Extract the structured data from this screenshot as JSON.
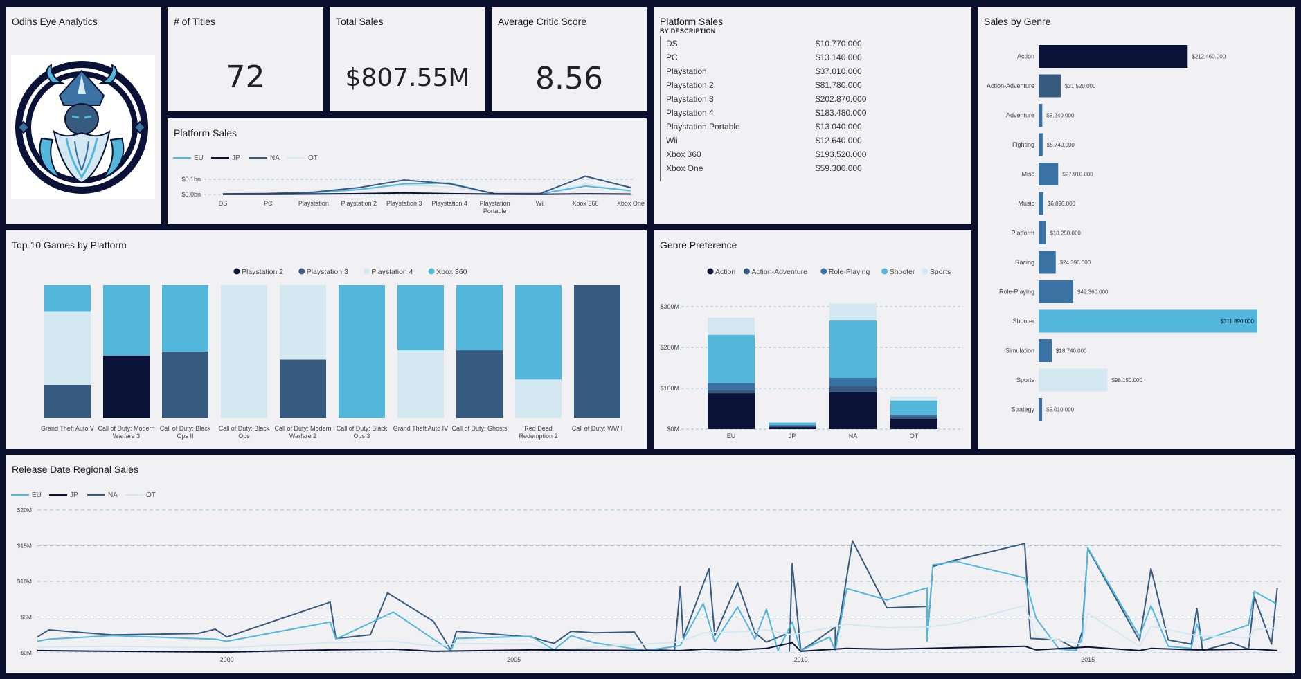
{
  "colors": {
    "background": "#0a0f2e",
    "card": "#f1f1f4",
    "navy": "#0b1237",
    "slate": "#375a7f",
    "sky": "#52b7da",
    "pale": "#d3e8f1"
  },
  "logo_card": {
    "title": "Odins Eye Analytics",
    "logo_icon": "viking-odin-logo-icon"
  },
  "kpis": [
    {
      "title": "# of Titles",
      "value": "72"
    },
    {
      "title": "Total Sales",
      "value": "$807.55M"
    },
    {
      "title": "Average Critic Score",
      "value": "8.56"
    }
  ],
  "platform_line": {
    "title": "Platform Sales",
    "legend": [
      "EU",
      "JP",
      "NA",
      "OT"
    ],
    "categories": [
      "DS",
      "PC",
      "Playstation",
      "Playstation 2",
      "Playstation 3",
      "Playstation 4",
      "Playstation Portable",
      "Wii",
      "Xbox 360",
      "Xbox One"
    ],
    "yticks": [
      "$0.1bn",
      "$0.0bn"
    ]
  },
  "platform_table": {
    "title": "Platform Sales",
    "subtitle": "BY DESCRIPTION",
    "rows": [
      {
        "name": "DS",
        "value": "$10.770.000"
      },
      {
        "name": "PC",
        "value": "$13.140.000"
      },
      {
        "name": "Playstation",
        "value": "$37.010.000"
      },
      {
        "name": "Playstation 2",
        "value": "$81.780.000"
      },
      {
        "name": "Playstation 3",
        "value": "$202.870.000"
      },
      {
        "name": "Playstation 4",
        "value": "$183.480.000"
      },
      {
        "name": "Playstation Portable",
        "value": "$13.040.000"
      },
      {
        "name": "Wii",
        "value": "$12.640.000"
      },
      {
        "name": "Xbox 360",
        "value": "$193.520.000"
      },
      {
        "name": "Xbox One",
        "value": "$59.300.000"
      }
    ]
  },
  "genre_bar": {
    "title": "Sales by Genre",
    "items": [
      {
        "genre": "Action",
        "label": "$212.460.000",
        "value": 212.46,
        "color": "#0b1237"
      },
      {
        "genre": "Action-Adventure",
        "label": "$31.520.000",
        "value": 31.52,
        "color": "#375a7f"
      },
      {
        "genre": "Adventure",
        "label": "$5.240.000",
        "value": 5.24,
        "color": "#3a72a4"
      },
      {
        "genre": "Fighting",
        "label": "$5.740.000",
        "value": 5.74,
        "color": "#3a72a4"
      },
      {
        "genre": "Misc",
        "label": "$27.910.000",
        "value": 27.91,
        "color": "#3a72a4"
      },
      {
        "genre": "Music",
        "label": "$6.890.000",
        "value": 6.89,
        "color": "#3a72a4"
      },
      {
        "genre": "Platform",
        "label": "$10.250.000",
        "value": 10.25,
        "color": "#3a72a4"
      },
      {
        "genre": "Racing",
        "label": "$24.390.000",
        "value": 24.39,
        "color": "#3a72a4"
      },
      {
        "genre": "Role-Playing",
        "label": "$49.360.000",
        "value": 49.36,
        "color": "#3a72a4"
      },
      {
        "genre": "Shooter",
        "label": "$311.890.000",
        "value": 311.89,
        "color": "#52b7da"
      },
      {
        "genre": "Simulation",
        "label": "$18.740.000",
        "value": 18.74,
        "color": "#3a72a4"
      },
      {
        "genre": "Sports",
        "label": "$98.150.000",
        "value": 98.15,
        "color": "#d3e8f1"
      },
      {
        "genre": "Strategy",
        "label": "$5.010.000",
        "value": 5.01,
        "color": "#3a72a4"
      }
    ]
  },
  "top10": {
    "title": "Top 10 Games by Platform",
    "legend": [
      {
        "name": "Playstation 2",
        "color": "#0b1237"
      },
      {
        "name": "Playstation 3",
        "color": "#375a7f"
      },
      {
        "name": "Playstation 4",
        "color": "#d3e8f1"
      },
      {
        "name": "Xbox 360",
        "color": "#52b7da"
      }
    ],
    "games": [
      {
        "name": [
          "Grand Theft Auto V"
        ],
        "segments": [
          [
            "Playstation 3",
            0.25
          ],
          [
            "Playstation 4",
            0.55
          ],
          [
            "Xbox 360",
            0.2
          ]
        ]
      },
      {
        "name": [
          "Call of Duty: Modern",
          "Warfare 3"
        ],
        "segments": [
          [
            "Playstation 2",
            0.47
          ],
          [
            "Xbox 360",
            0.53
          ]
        ]
      },
      {
        "name": [
          "Call of Duty: Black",
          "Ops II"
        ],
        "segments": [
          [
            "Playstation 3",
            0.5
          ],
          [
            "Xbox 360",
            0.5
          ]
        ]
      },
      {
        "name": [
          "Call of Duty: Black",
          "Ops"
        ],
        "segments": [
          [
            "Playstation 4",
            1.0
          ]
        ]
      },
      {
        "name": [
          "Call of Duty: Modern",
          "Warfare 2"
        ],
        "segments": [
          [
            "Playstation 3",
            0.44
          ],
          [
            "Playstation 4",
            0.56
          ]
        ]
      },
      {
        "name": [
          "Call of Duty: Black",
          "Ops 3"
        ],
        "segments": [
          [
            "Xbox 360",
            1.0
          ]
        ]
      },
      {
        "name": [
          "Grand Theft Auto IV"
        ],
        "segments": [
          [
            "Playstation 4",
            0.51
          ],
          [
            "Xbox 360",
            0.49
          ]
        ]
      },
      {
        "name": [
          "Call of Duty: Ghosts"
        ],
        "segments": [
          [
            "Playstation 3",
            0.51
          ],
          [
            "Xbox 360",
            0.49
          ]
        ]
      },
      {
        "name": [
          "Red Dead",
          "Redemption 2"
        ],
        "segments": [
          [
            "Playstation 4",
            0.29
          ],
          [
            "Xbox 360",
            0.71
          ]
        ]
      },
      {
        "name": [
          "Call of Duty: WWII"
        ],
        "segments": [
          [
            "Playstation 3",
            1.0
          ]
        ]
      }
    ]
  },
  "genre_pref": {
    "title": "Genre Preference",
    "legend": [
      {
        "name": "Action",
        "color": "#0b1237"
      },
      {
        "name": "Action-Adventure",
        "color": "#375a7f"
      },
      {
        "name": "Role-Playing",
        "color": "#3a72a4"
      },
      {
        "name": "Shooter",
        "color": "#52b7da"
      },
      {
        "name": "Sports",
        "color": "#d3e8f1"
      }
    ],
    "yticks": [
      "$300M",
      "$200M",
      "$100M",
      "$0M"
    ],
    "ymax": 300,
    "regions": [
      {
        "name": "EU",
        "values": [
          88,
          8,
          17,
          118,
          42
        ]
      },
      {
        "name": "JP",
        "values": [
          5,
          2,
          3,
          6,
          2
        ]
      },
      {
        "name": "NA",
        "values": [
          90,
          16,
          20,
          140,
          42
        ]
      },
      {
        "name": "OT",
        "values": [
          26,
          4,
          6,
          34,
          10
        ]
      }
    ]
  },
  "release": {
    "title": "Release Date Regional Sales",
    "legend": [
      "EU",
      "JP",
      "NA",
      "OT"
    ],
    "yticks": [
      "$20M",
      "$15M",
      "$10M",
      "$5M",
      "$0M"
    ],
    "xticks": [
      "2000",
      "2005",
      "2010",
      "2015"
    ],
    "ymax": 20,
    "xrange": [
      1996.7,
      2018.4
    ],
    "series": [
      {
        "name": "NA",
        "color": "#375a7f",
        "points": [
          [
            1996.7,
            2.2
          ],
          [
            1996.9,
            3.2
          ],
          [
            1998,
            2.5
          ],
          [
            1999.5,
            2.7
          ],
          [
            1999.8,
            3.3
          ],
          [
            2000,
            2.2
          ],
          [
            2001.8,
            7.1
          ],
          [
            2001.9,
            2
          ],
          [
            2002.5,
            2.5
          ],
          [
            2002.8,
            8.4
          ],
          [
            2003.6,
            4.4
          ],
          [
            2003.9,
            0.4
          ],
          [
            2004,
            3
          ],
          [
            2005.3,
            2.2
          ],
          [
            2005.7,
            1.3
          ],
          [
            2006,
            3
          ],
          [
            2006.4,
            2.8
          ],
          [
            2007.1,
            2.9
          ],
          [
            2007.3,
            0.5
          ],
          [
            2007.8,
            0.3
          ],
          [
            2007.9,
            9.3
          ],
          [
            2007.95,
            2.1
          ],
          [
            2008.4,
            11.8
          ],
          [
            2008.5,
            2.4
          ],
          [
            2008.9,
            9.8
          ],
          [
            2009.2,
            2.8
          ],
          [
            2009.4,
            1.5
          ],
          [
            2009.8,
            2.8
          ],
          [
            2009.8,
            0.2
          ],
          [
            2009.85,
            12.5
          ],
          [
            2010,
            0.3
          ],
          [
            2010.2,
            1.3
          ],
          [
            2010.6,
            3.6
          ],
          [
            2010.6,
            0.5
          ],
          [
            2010.9,
            15.7
          ],
          [
            2011.5,
            6.3
          ],
          [
            2012.2,
            6.5
          ],
          [
            2012.2,
            1.7
          ],
          [
            2012.3,
            12.1
          ],
          [
            2012.7,
            13
          ],
          [
            2013.9,
            15.3
          ],
          [
            2014,
            2
          ],
          [
            2014.5,
            1.8
          ],
          [
            2014.8,
            0.5
          ],
          [
            2014.9,
            2.9
          ],
          [
            2015,
            14.6
          ],
          [
            2015.9,
            1.7
          ],
          [
            2016.1,
            11.8
          ],
          [
            2016.4,
            1.8
          ],
          [
            2016.8,
            1.2
          ],
          [
            2016.9,
            6.2
          ],
          [
            2017,
            0.3
          ],
          [
            2017.5,
            1.4
          ],
          [
            2017.8,
            0.5
          ],
          [
            2017.9,
            7.9
          ],
          [
            2018.2,
            1.2
          ],
          [
            2018.3,
            9.1
          ]
        ]
      },
      {
        "name": "EU",
        "color": "#52b7da",
        "points": [
          [
            1996.7,
            1.6
          ],
          [
            1996.9,
            1.9
          ],
          [
            1998,
            2.4
          ],
          [
            1999.8,
            1.9
          ],
          [
            2000,
            1.6
          ],
          [
            2001.8,
            4.3
          ],
          [
            2001.9,
            1.9
          ],
          [
            2002.9,
            5.7
          ],
          [
            2003.6,
            1.9
          ],
          [
            2003.9,
            0.3
          ],
          [
            2004,
            2
          ],
          [
            2005.3,
            2.3
          ],
          [
            2005.7,
            0.4
          ],
          [
            2006,
            2.4
          ],
          [
            2006.4,
            1.4
          ],
          [
            2007.3,
            0.3
          ],
          [
            2007.9,
            1
          ],
          [
            2008.3,
            6.9
          ],
          [
            2008.5,
            1.5
          ],
          [
            2008.9,
            6.4
          ],
          [
            2009.2,
            1.9
          ],
          [
            2009.4,
            6.1
          ],
          [
            2009.6,
            0.3
          ],
          [
            2009.85,
            4.3
          ],
          [
            2010,
            0.3
          ],
          [
            2010.5,
            2.2
          ],
          [
            2010.6,
            0.3
          ],
          [
            2010.8,
            9
          ],
          [
            2011.5,
            7.4
          ],
          [
            2012.2,
            9.1
          ],
          [
            2012.2,
            1.6
          ],
          [
            2012.3,
            12.3
          ],
          [
            2012.7,
            12.8
          ],
          [
            2013.9,
            10.5
          ],
          [
            2014.1,
            4.8
          ],
          [
            2014.5,
            0.5
          ],
          [
            2014.8,
            0.3
          ],
          [
            2014.9,
            2
          ],
          [
            2015,
            14.7
          ],
          [
            2015.9,
            2.3
          ],
          [
            2016.1,
            6.6
          ],
          [
            2016.4,
            0.9
          ],
          [
            2016.8,
            0.6
          ],
          [
            2016.9,
            4
          ],
          [
            2017,
            1.7
          ],
          [
            2017.8,
            3.9
          ],
          [
            2017.9,
            8.6
          ],
          [
            2018.3,
            6.8
          ]
        ]
      },
      {
        "name": "OT",
        "color": "#d3e8f1",
        "points": [
          [
            1996.7,
            0.8
          ],
          [
            1998,
            0.9
          ],
          [
            2000,
            0.7
          ],
          [
            2001.8,
            1.4
          ],
          [
            2002.9,
            1.6
          ],
          [
            2003.6,
            0.9
          ],
          [
            2004,
            1.3
          ],
          [
            2005.3,
            1.2
          ],
          [
            2005.7,
            0.3
          ],
          [
            2006.4,
            0.8
          ],
          [
            2007.9,
            1.5
          ],
          [
            2008.3,
            2.8
          ],
          [
            2008.9,
            2.9
          ],
          [
            2009.4,
            3.2
          ],
          [
            2009.85,
            2.5
          ],
          [
            2010.8,
            4
          ],
          [
            2011.5,
            3.5
          ],
          [
            2012.2,
            3.6
          ],
          [
            2012.7,
            4.1
          ],
          [
            2013.9,
            6.6
          ],
          [
            2014.1,
            2.3
          ],
          [
            2014.9,
            1.2
          ],
          [
            2015,
            5.5
          ],
          [
            2015.9,
            0.9
          ],
          [
            2016.1,
            3.7
          ],
          [
            2016.9,
            2.4
          ],
          [
            2017.8,
            2.1
          ],
          [
            2017.9,
            3.2
          ],
          [
            2018.3,
            3.5
          ]
        ]
      },
      {
        "name": "JP",
        "color": "#0b1237",
        "points": [
          [
            1996.7,
            0.3
          ],
          [
            1998,
            0.2
          ],
          [
            2000,
            0.1
          ],
          [
            2001.8,
            0.4
          ],
          [
            2002.9,
            0.5
          ],
          [
            2003.6,
            0.2
          ],
          [
            2005.3,
            0.4
          ],
          [
            2007.9,
            0.3
          ],
          [
            2008.3,
            0.5
          ],
          [
            2008.9,
            0.4
          ],
          [
            2009.4,
            0.6
          ],
          [
            2009.85,
            1.4
          ],
          [
            2010,
            0.2
          ],
          [
            2010.8,
            0.6
          ],
          [
            2011.5,
            0.5
          ],
          [
            2012.2,
            0.6
          ],
          [
            2012.7,
            0.7
          ],
          [
            2013.9,
            0.9
          ],
          [
            2014.1,
            0.4
          ],
          [
            2015,
            0.8
          ],
          [
            2015.9,
            0.3
          ],
          [
            2016.1,
            0.6
          ],
          [
            2016.9,
            0.4
          ],
          [
            2017.9,
            0.5
          ],
          [
            2018.3,
            0.3
          ]
        ]
      }
    ]
  }
}
